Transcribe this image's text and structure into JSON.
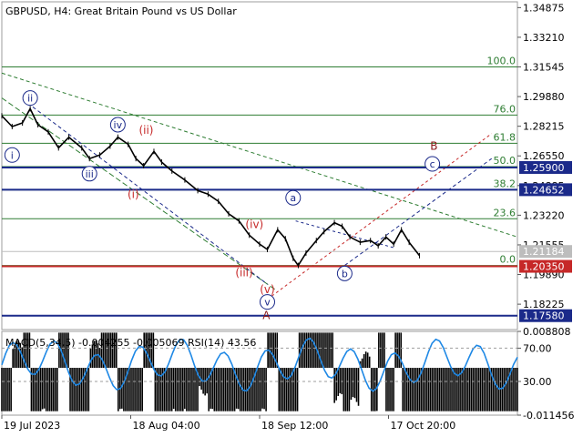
{
  "header": {
    "symbol_title": "GBPUSD, H4:  Great Britain Pound vs US Dollar",
    "indicator_title": "MACD(5,34,5) -0.004255 -0.005069 RSI(14) 43.56"
  },
  "chart_data": {
    "type": "candlestick-line",
    "title": "GBPUSD, H4:  Great Britain Pound vs US Dollar",
    "price_axis": {
      "ylim": [
        1.168,
        1.352
      ],
      "tick_labels": [
        "1.34875",
        "1.33210",
        "1.31545",
        "1.29880",
        "1.28215",
        "1.26550",
        "1.24885",
        "1.23220",
        "1.21555",
        "1.19890",
        "1.18225"
      ],
      "tick_values": [
        1.34875,
        1.3321,
        1.31545,
        1.2988,
        1.28215,
        1.2655,
        1.24885,
        1.2322,
        1.21555,
        1.1989,
        1.18225
      ]
    },
    "time_axis": {
      "labels": [
        "19 Jul 2023",
        "18 Aug 04:00",
        "18 Sep 12:00",
        "17 Oct 20:00"
      ],
      "positions": [
        0,
        0.25,
        0.5,
        0.75
      ]
    },
    "price_series_approx": [
      [
        0.0,
        1.288
      ],
      [
        0.02,
        1.282
      ],
      [
        0.04,
        1.284
      ],
      [
        0.055,
        1.292
      ],
      [
        0.07,
        1.283
      ],
      [
        0.09,
        1.279
      ],
      [
        0.11,
        1.27
      ],
      [
        0.13,
        1.276
      ],
      [
        0.155,
        1.27
      ],
      [
        0.17,
        1.264
      ],
      [
        0.19,
        1.266
      ],
      [
        0.21,
        1.271
      ],
      [
        0.225,
        1.276
      ],
      [
        0.245,
        1.272
      ],
      [
        0.26,
        1.264
      ],
      [
        0.275,
        1.26
      ],
      [
        0.295,
        1.268
      ],
      [
        0.31,
        1.262
      ],
      [
        0.33,
        1.257
      ],
      [
        0.355,
        1.252
      ],
      [
        0.38,
        1.246
      ],
      [
        0.4,
        1.244
      ],
      [
        0.42,
        1.24
      ],
      [
        0.44,
        1.233
      ],
      [
        0.46,
        1.229
      ],
      [
        0.48,
        1.221
      ],
      [
        0.5,
        1.216
      ],
      [
        0.515,
        1.213
      ],
      [
        0.535,
        1.224
      ],
      [
        0.55,
        1.219
      ],
      [
        0.565,
        1.208
      ],
      [
        0.575,
        1.204
      ],
      [
        0.59,
        1.211
      ],
      [
        0.61,
        1.218
      ],
      [
        0.625,
        1.223
      ],
      [
        0.645,
        1.228
      ],
      [
        0.66,
        1.226
      ],
      [
        0.675,
        1.22
      ],
      [
        0.695,
        1.217
      ],
      [
        0.715,
        1.218
      ],
      [
        0.73,
        1.215
      ],
      [
        0.745,
        1.22
      ],
      [
        0.76,
        1.216
      ],
      [
        0.775,
        1.224
      ],
      [
        0.79,
        1.217
      ],
      [
        0.81,
        1.2095
      ]
    ],
    "fibonacci_levels": [
      {
        "label": "100.0",
        "value": 1.31545
      },
      {
        "label": "76.0",
        "value": 1.2884
      },
      {
        "label": "61.8",
        "value": 1.2726
      },
      {
        "label": "50.0",
        "value": 1.2595
      },
      {
        "label": "38.2",
        "value": 1.2464
      },
      {
        "label": "23.6",
        "value": 1.2302
      },
      {
        "label": "0.0",
        "value": 1.204
      }
    ],
    "price_levels": [
      {
        "label": "1.25900",
        "value": 1.259,
        "color": "#1b2a8a"
      },
      {
        "label": "1.24652",
        "value": 1.24652,
        "color": "#1b2a8a"
      },
      {
        "label": "1.21184",
        "value": 1.21184,
        "color": "#bdbdbd"
      },
      {
        "label": "1.20350",
        "value": 1.2035,
        "color": "#c62828"
      },
      {
        "label": "1.17580",
        "value": 1.1758,
        "color": "#1b2a8a"
      }
    ],
    "wave_labels": [
      {
        "text": "i",
        "style": "blue-circle",
        "x": 0.02,
        "y": 1.266
      },
      {
        "text": "ii",
        "style": "blue-circle",
        "x": 0.055,
        "y": 1.298
      },
      {
        "text": "iii",
        "style": "blue-circle",
        "x": 0.17,
        "y": 1.2555
      },
      {
        "text": "iv",
        "style": "blue-circle",
        "x": 0.225,
        "y": 1.283
      },
      {
        "text": "(ii)",
        "style": "red",
        "x": 0.28,
        "y": 1.28
      },
      {
        "text": "(i)",
        "style": "red",
        "x": 0.255,
        "y": 1.244
      },
      {
        "text": "(iv)",
        "style": "red",
        "x": 0.49,
        "y": 1.227
      },
      {
        "text": "(iii)",
        "style": "red",
        "x": 0.47,
        "y": 1.2
      },
      {
        "text": "(v)",
        "style": "red",
        "x": 0.515,
        "y": 1.1905
      },
      {
        "text": "v",
        "style": "blue-circle",
        "x": 0.515,
        "y": 1.1835
      },
      {
        "text": "A",
        "style": "darkred",
        "x": 0.513,
        "y": 1.176
      },
      {
        "text": "a",
        "style": "blue-circle",
        "x": 0.565,
        "y": 1.242
      },
      {
        "text": "b",
        "style": "blue-circle",
        "x": 0.665,
        "y": 1.1995
      },
      {
        "text": "B",
        "style": "darkred",
        "x": 0.838,
        "y": 1.271
      },
      {
        "text": "c",
        "style": "blue-circle",
        "x": 0.835,
        "y": 1.261
      }
    ],
    "indicator": {
      "name": "MACD(5,34,5) RSI(14)",
      "macd_main": -0.004255,
      "macd_signal": -0.005069,
      "rsi": 43.56,
      "ylim": [
        -0.011456,
        0.008808
      ],
      "tick_labels": [
        "0.008808",
        "70.00",
        "30.00",
        "-0.011456"
      ],
      "tick_values": [
        0.008808,
        0.004752,
        -0.0033,
        -0.011456
      ],
      "rsi_levels": [
        70,
        30
      ]
    }
  }
}
